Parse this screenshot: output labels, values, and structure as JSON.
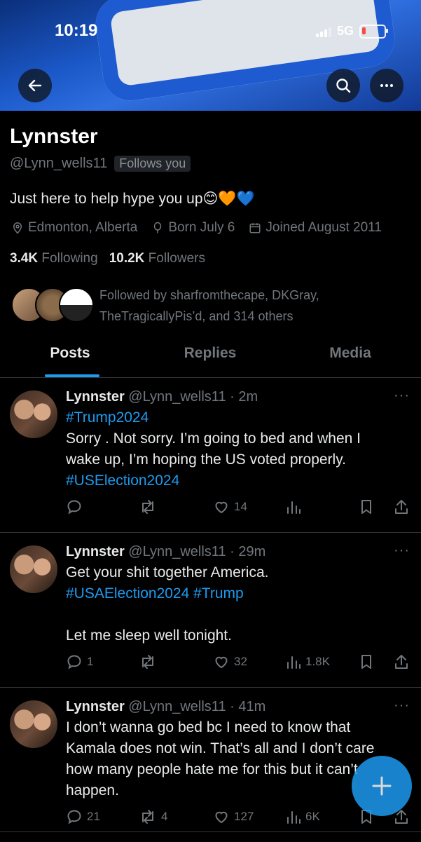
{
  "status_bar": {
    "time": "10:19",
    "network": "5G"
  },
  "profile": {
    "name": "Lynnster",
    "handle": "@Lynn_wells11",
    "follows_you": "Follows you",
    "bio": "Just here to help hype you up😊🧡💙",
    "location": "Edmonton, Alberta",
    "birthday": "Born July 6",
    "joined": "Joined August 2011",
    "following_count": "3.4K",
    "following_label": "Following",
    "followers_count": "10.2K",
    "followers_label": "Followers",
    "followed_by_line1": "Followed by sharfromthecape, DKGray,",
    "followed_by_line2": "TheTragicallyPis’d, and 314 others"
  },
  "tabs": [
    {
      "label": "Posts",
      "active": true
    },
    {
      "label": "Replies"
    },
    {
      "label": "Media"
    }
  ],
  "posts": [
    {
      "name": "Lynnster",
      "meta": "@Lynn_wells11 · 2m",
      "lines": [
        {
          "tag": "#Trump2024"
        },
        {
          "text": "Sorry . Not sorry. I’m going to bed and when I"
        },
        {
          "text": "wake up, I’m hoping the US voted properly."
        },
        {
          "tag": "#USElection2024"
        }
      ],
      "replies": "",
      "reposts": "",
      "likes": "14",
      "views": ""
    },
    {
      "name": "Lynnster",
      "meta": "@Lynn_wells11 · 29m",
      "lines": [
        {
          "text": "Get your shit together America."
        },
        {
          "tag": "#USAElection2024 #Trump"
        },
        {
          "text": ""
        },
        {
          "text": "Let me sleep well tonight."
        }
      ],
      "replies": "1",
      "reposts": "",
      "likes": "32",
      "views": "1.8K"
    },
    {
      "name": "Lynnster",
      "meta": "@Lynn_wells11 · 41m",
      "lines": [
        {
          "text": "I don’t wanna go bed bc I need to know that"
        },
        {
          "text": "Kamala does not win. That’s all and I don’t care"
        },
        {
          "text": "how many people hate me for this but it can’t"
        },
        {
          "text": "happen."
        }
      ],
      "replies": "21",
      "reposts": "4",
      "likes": "127",
      "views": "6K"
    }
  ],
  "colors": {
    "accent": "#1d9bf0",
    "muted": "#71767b",
    "background": "#000000"
  }
}
